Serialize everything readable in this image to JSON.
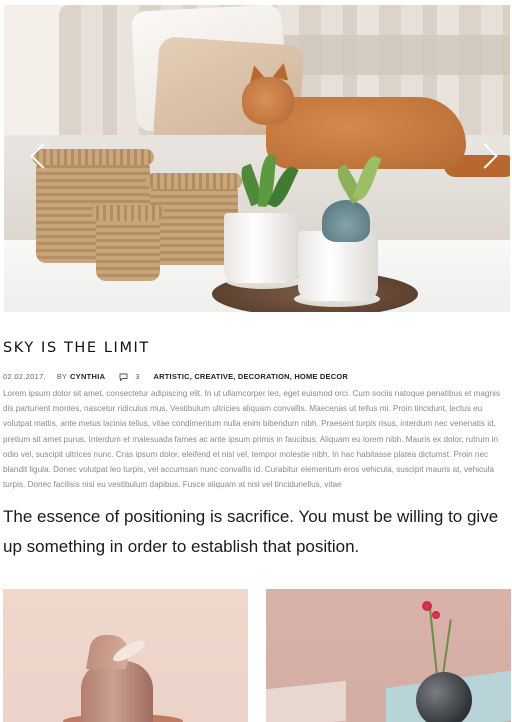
{
  "hero": {
    "prev_arrow_icon": "chevron-left-icon",
    "next_arrow_icon": "chevron-right-icon"
  },
  "post": {
    "title": "SKY IS THE LIMIT",
    "date": "02.02.2017.",
    "by_label": "BY",
    "author": "CYNTHIA",
    "comment_icon": "speech-bubble-icon",
    "comment_count": "3",
    "categories": [
      "ARTISTIC",
      "CREATIVE",
      "DECORATION",
      "HOME DECOR"
    ],
    "category_separator": ", ",
    "excerpt": "Lorem ipsum dolor sit amet, consectetur adipiscing elit. In ut ullamcorper leo, eget euismod orci. Cum sociis natoque penatibus et magnis dis parturient montes, nascetur ridiculus mus. Vestibulum ultricies aliquam convallis. Maecenas ut tellus mi. Proin tincidunt, lectus eu volutpat mattis, ante metus lacinia tellus, vitae condimentum nulla enim bibendum nibh. Praesent turpis risus, interdum nec venenatis id, pretium sit amet purus. Interdum et malesuada fames ac ante ipsum primis in faucibus. Aliquam eu lorem nibh. Mauris ex dolor, rutrum in odio vel, suscipit ultrices nunc. Cras ipsum dolor, eleifend et nisl vel, tempor molestie nibh. In hac habitasse platea dictumst. Proin nec blandit ligula. Donec volutpat leo turpis, vel accumsan nunc convallis id. Curabitur elementum eros vehicula, suscipit mauris at, vehicula turpis. Donec facilisis nisi eu vestibulum dapibus. Fusce aliquam at nisl vel tincidunellus, vitae",
    "quote": "The essence of positioning is sacrifice. You must be willing to give up something in order to establish that position."
  },
  "colors": {
    "title": "#111111",
    "body_text": "#8a8a8a",
    "quote_text": "#1b1b1b",
    "left_thumb_bg": "#f0d7cc",
    "right_thumb_bg": "#d9b2aa"
  }
}
